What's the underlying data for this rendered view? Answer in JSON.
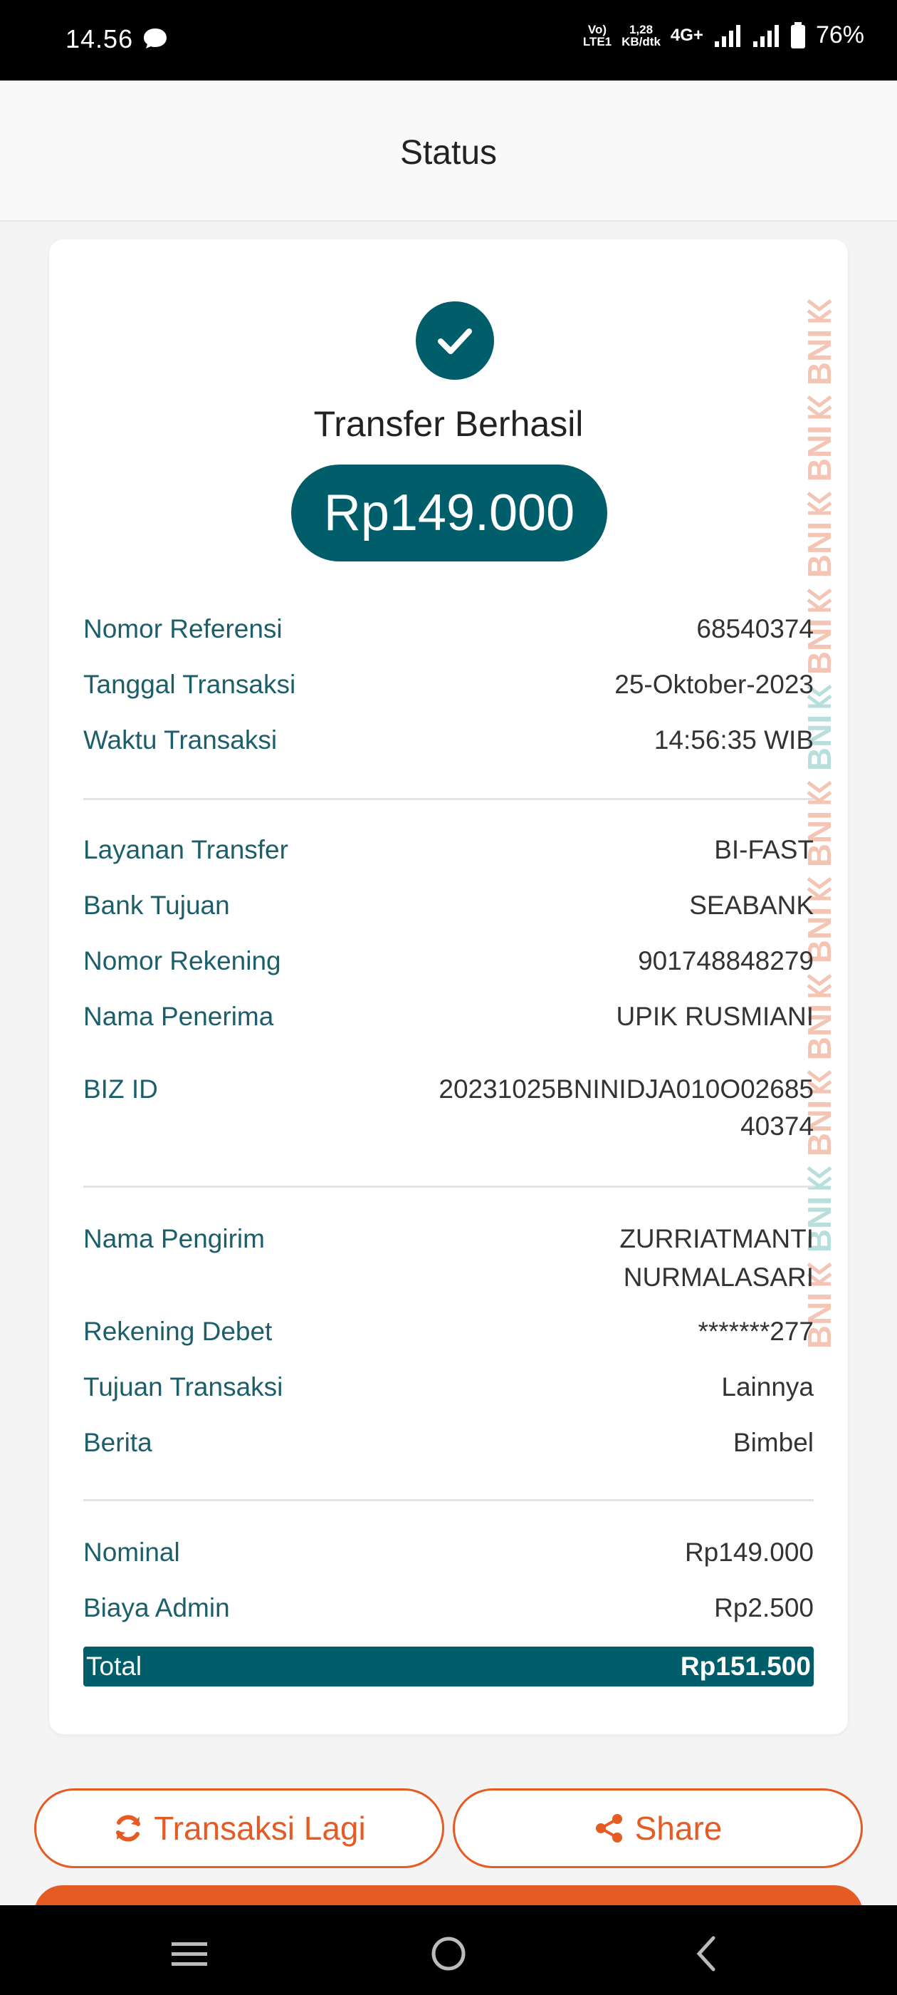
{
  "status_bar": {
    "time": "14.56",
    "volte_line1": "Vo)",
    "volte_line2": "LTE1",
    "speed_line1": "1,28",
    "speed_line2": "KB/dtk",
    "network": "4G+",
    "battery": "76%"
  },
  "header": {
    "title": "Status"
  },
  "receipt": {
    "success_title": "Transfer Berhasil",
    "amount": "Rp149.000",
    "watermark_text": "BNI",
    "section1": [
      {
        "label": "Nomor Referensi",
        "value": "68540374"
      },
      {
        "label": "Tanggal Transaksi",
        "value": "25-Oktober-2023"
      },
      {
        "label": "Waktu Transaksi",
        "value": "14:56:35 WIB"
      }
    ],
    "section2": [
      {
        "label": "Layanan Transfer",
        "value": "BI-FAST"
      },
      {
        "label": "Bank Tujuan",
        "value": "SEABANK"
      },
      {
        "label": "Nomor Rekening",
        "value": "901748848279"
      },
      {
        "label": "Nama Penerima",
        "value": "UPIK RUSMIANI"
      },
      {
        "label": "BIZ ID",
        "value_line1": "20231025BNINIDJA010O02685",
        "value_line2": "40374"
      }
    ],
    "section3": [
      {
        "label": "Nama Pengirim",
        "value_line1": "ZURRIATMANTI",
        "value_line2": "NURMALASARI"
      },
      {
        "label": "Rekening Debet",
        "value": "*******277"
      },
      {
        "label": "Tujuan Transaksi",
        "value": "Lainnya"
      },
      {
        "label": "Berita",
        "value": "Bimbel"
      }
    ],
    "section4": [
      {
        "label": "Nominal",
        "value": "Rp149.000"
      },
      {
        "label": "Biaya Admin",
        "value": "Rp2.500"
      }
    ],
    "total": {
      "label": "Total",
      "value": "Rp151.500"
    }
  },
  "actions": {
    "again_label": "Transaksi Lagi",
    "share_label": "Share"
  },
  "colors": {
    "primary": "#005e6a",
    "accent": "#e55b24"
  }
}
